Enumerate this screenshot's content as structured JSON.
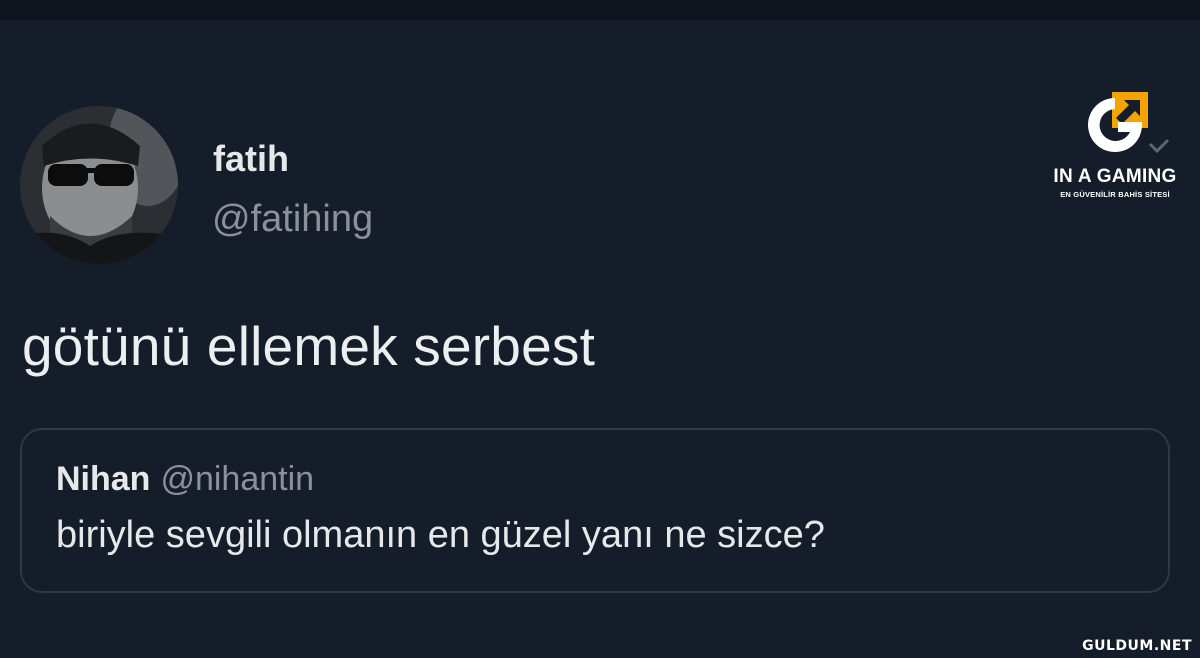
{
  "tweet": {
    "author_name": "fatih",
    "author_handle": "@fatihing",
    "text": "götünü ellemek serbest"
  },
  "quoted_tweet": {
    "author_name": "Nihan",
    "author_handle": "@nihantin",
    "text": "biriyle sevgili olmanın en güzel yanı ne sizce?"
  },
  "brand_logo": {
    "icon": "g-arrow-logo-icon",
    "title": "IN A GAMING",
    "subtitle": "EN GÜVENİLİR BAHİS SİTESİ",
    "accent_color": "#f5a300"
  },
  "watermark": {
    "text": "GULDUM.NET"
  },
  "colors": {
    "background": "#141d29",
    "text_primary": "#eceef0",
    "text_secondary": "#8a9198",
    "card_border": "#2e3945"
  }
}
